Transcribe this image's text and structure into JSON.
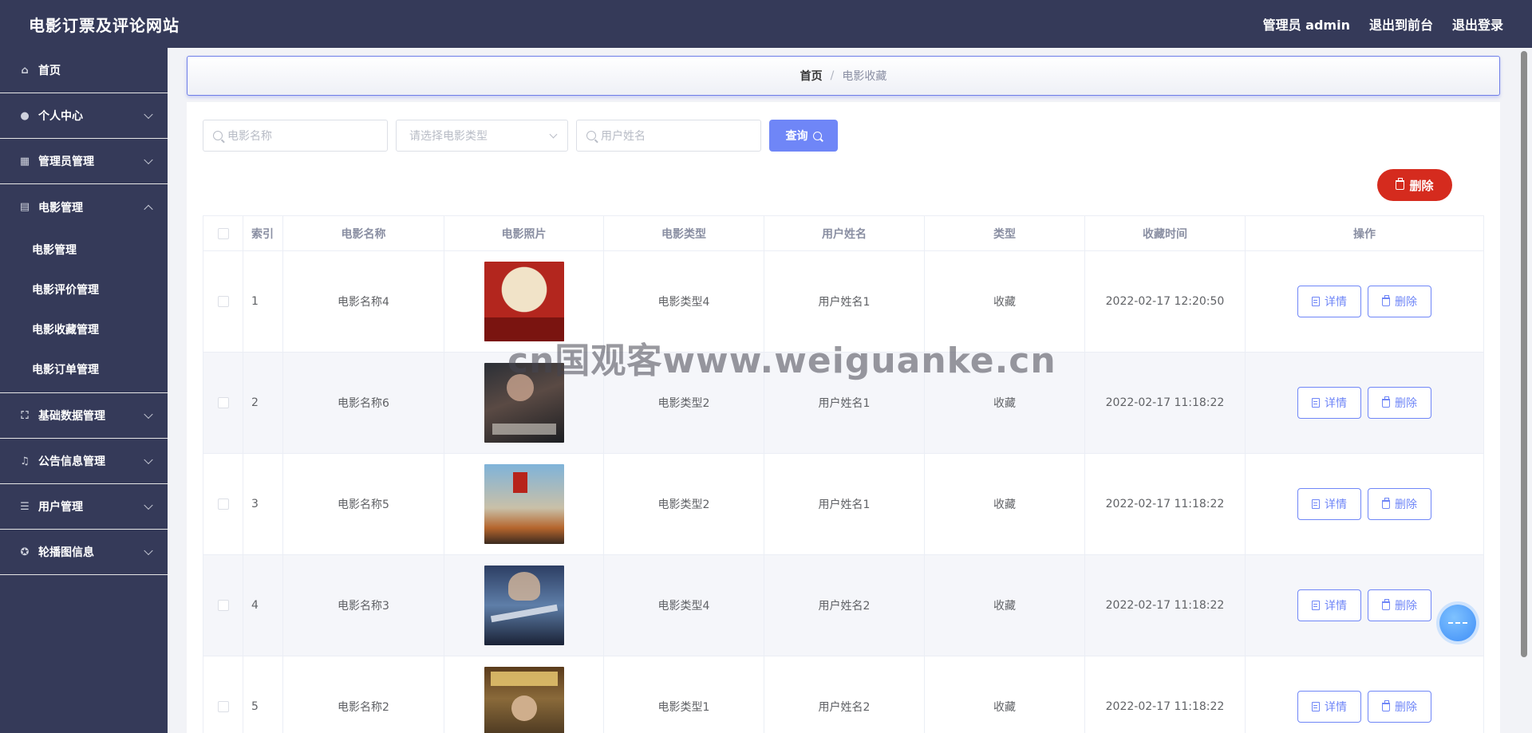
{
  "app": {
    "title": "电影订票及评论网站"
  },
  "header": {
    "user_label": "管理员 admin",
    "to_front": "退出到前台",
    "logout": "退出登录"
  },
  "sidebar": {
    "items": [
      {
        "label": "首页",
        "icon": "home-icon"
      },
      {
        "label": "个人中心",
        "icon": "user-icon"
      },
      {
        "label": "管理员管理",
        "icon": "grid-icon"
      },
      {
        "label": "电影管理",
        "icon": "clipboard-icon"
      },
      {
        "label": "基础数据管理",
        "icon": "frame-icon"
      },
      {
        "label": "公告信息管理",
        "icon": "microphone-icon"
      },
      {
        "label": "用户管理",
        "icon": "list-icon"
      },
      {
        "label": "轮播图信息",
        "icon": "aperture-icon"
      }
    ],
    "movie_sub": [
      "电影管理",
      "电影评价管理",
      "电影收藏管理",
      "电影订单管理"
    ]
  },
  "breadcrumb": {
    "home": "首页",
    "separator": "/",
    "current": "电影收藏"
  },
  "search": {
    "name_placeholder": "电影名称",
    "type_placeholder": "请选择电影类型",
    "user_placeholder": "用户姓名",
    "query_label": "查询"
  },
  "actions": {
    "delete_label": "删除"
  },
  "table": {
    "headers": [
      "索引",
      "电影名称",
      "电影照片",
      "电影类型",
      "用户姓名",
      "类型",
      "收藏时间",
      "操作"
    ],
    "rows": [
      {
        "idx": "1",
        "name": "电影名称4",
        "type": "电影类型4",
        "user": "用户姓名1",
        "kind": "收藏",
        "time": "2022-02-17 12:20:50"
      },
      {
        "idx": "2",
        "name": "电影名称6",
        "type": "电影类型2",
        "user": "用户姓名1",
        "kind": "收藏",
        "time": "2022-02-17 11:18:22"
      },
      {
        "idx": "3",
        "name": "电影名称5",
        "type": "电影类型2",
        "user": "用户姓名1",
        "kind": "收藏",
        "time": "2022-02-17 11:18:22"
      },
      {
        "idx": "4",
        "name": "电影名称3",
        "type": "电影类型4",
        "user": "用户姓名2",
        "kind": "收藏",
        "time": "2022-02-17 11:18:22"
      },
      {
        "idx": "5",
        "name": "电影名称2",
        "type": "电影类型1",
        "user": "用户姓名2",
        "kind": "收藏",
        "time": "2022-02-17 11:18:22"
      }
    ],
    "detail_label": "详情",
    "delete_label": "删除"
  },
  "watermark": "cn国观客www.weiguanke.cn",
  "colors": {
    "sidebar": "#353a59",
    "accent": "#6f86f7",
    "danger": "#d52b1e"
  }
}
